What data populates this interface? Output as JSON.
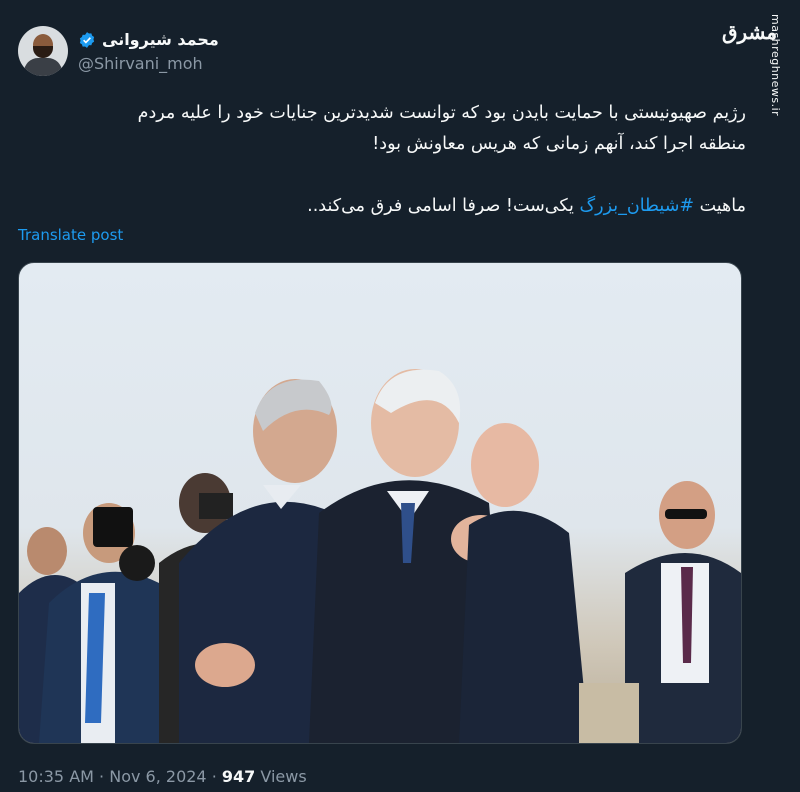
{
  "author": {
    "name": "محمد شیروانی",
    "handle": "@Shirvani_moh",
    "verified": true
  },
  "watermark": {
    "logo_text": "مشرق",
    "site": "mashreghnews.ir"
  },
  "post": {
    "line1": "رژیم صهیونیستی با حمایت بایدن بود که توانست شدیدترین جنایات خود را علیه مردم",
    "line2": "منطقه اجرا کند، آنهم زمانی که هریس معاونش بود!",
    "line3_before": "ماهیت ",
    "hashtag": "#شیطان_بزرگ",
    "line3_after": " یکی‌ست! صرفا اسامی فرق می‌کند..",
    "translate_label": "Translate post"
  },
  "meta": {
    "time": "10:35 AM",
    "separator": " · ",
    "date": "Nov 6, 2024",
    "views_count": "947",
    "views_label": "Views"
  },
  "colors": {
    "background": "#15202b",
    "link": "#1d9bf0",
    "muted": "#8b98a5"
  }
}
